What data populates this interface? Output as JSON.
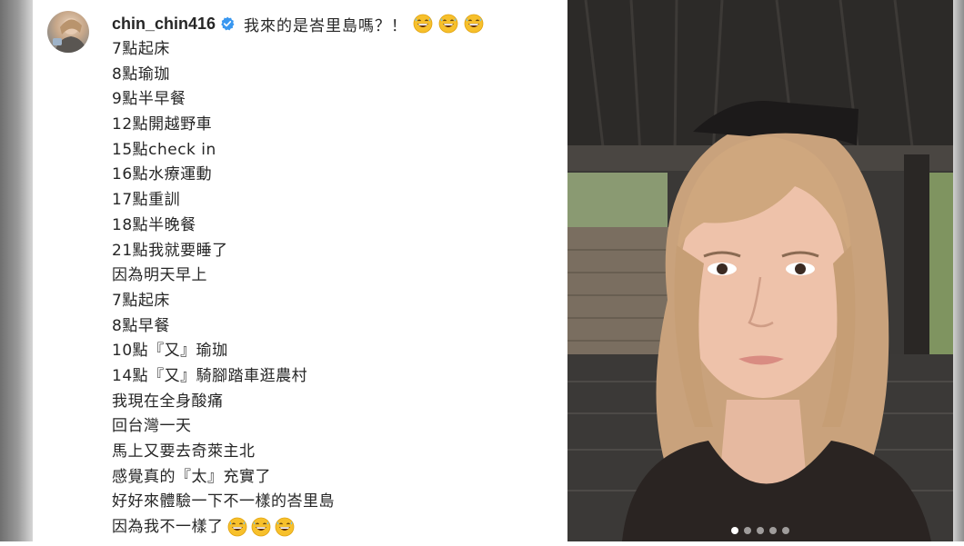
{
  "post": {
    "username": "chin_chin416",
    "verified": true,
    "headline": "我來的是峇里島嗎？！",
    "headline_emoji": [
      "grinning-sweat-emoji",
      "grinning-sweat-emoji",
      "grinning-sweat-emoji"
    ],
    "lines": [
      "7點起床",
      "8點瑜珈",
      "9點半早餐",
      "12點開越野車",
      "15點check in",
      "16點水療運動",
      "17點重訓",
      "18點半晚餐",
      "21點我就要睡了",
      "因為明天早上",
      "7點起床",
      "8點早餐",
      "10點『又』瑜珈",
      "14點『又』騎腳踏車逛農村",
      "我現在全身酸痛",
      "回台灣一天",
      "馬上又要去奇萊主北",
      "感覺真的『太』充實了",
      "好好來體驗一下不一樣的峇里島",
      "因為我不一樣了"
    ],
    "last_line_emoji": [
      "grinning-sweat-emoji",
      "grinning-sweat-emoji",
      "grinning-sweat-emoji"
    ]
  },
  "carousel": {
    "total_images": 5,
    "current_index": 1
  },
  "colors": {
    "text": "#262626",
    "verified_badge": "#3897f0",
    "emoji_face": "#f7c02b"
  }
}
